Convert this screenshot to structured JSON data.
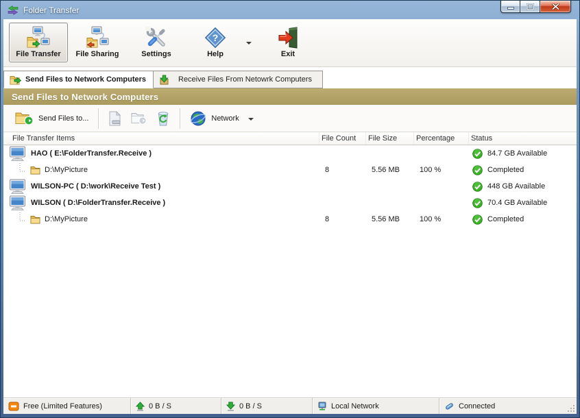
{
  "window": {
    "title": "Folder Transfer"
  },
  "toolbar": {
    "file_transfer": "File Transfer",
    "file_sharing": "File Sharing",
    "settings": "Settings",
    "help": "Help",
    "exit": "Exit"
  },
  "tabs": {
    "send": "Send Files to Network Computers",
    "receive": "Receive Files From Netowrk Computers"
  },
  "section_title": "Send Files to Network Computers",
  "actions": {
    "send_files": "Send Files to...",
    "network": "Network"
  },
  "table": {
    "columns": [
      "File Transfer Items",
      "File Count",
      "File Size",
      "Percentage",
      "Status"
    ],
    "rows": [
      {
        "type": "computer",
        "name": "HAO ( E:\\FolderTransfer.Receive )",
        "file_count": "",
        "file_size": "",
        "percentage": "",
        "status": "84.7 GB Available"
      },
      {
        "type": "folder",
        "name": "D:\\MyPicture",
        "file_count": "8",
        "file_size": "5.56 MB",
        "percentage": "100 %",
        "status": "Completed"
      },
      {
        "type": "computer",
        "name": "WILSON-PC ( D:\\work\\Receive Test )",
        "file_count": "",
        "file_size": "",
        "percentage": "",
        "status": "448 GB Available"
      },
      {
        "type": "computer",
        "name": "WILSON ( D:\\FolderTransfer.Receive )",
        "file_count": "",
        "file_size": "",
        "percentage": "",
        "status": "70.4 GB Available"
      },
      {
        "type": "folder",
        "name": "D:\\MyPicture",
        "file_count": "8",
        "file_size": "5.56 MB",
        "percentage": "100 %",
        "status": "Completed"
      }
    ]
  },
  "statusbar": {
    "license": "Free (Limited Features)",
    "upload": "0 B / S",
    "download": "0 B / S",
    "network": "Local Network",
    "connection": "Connected"
  },
  "colors": {
    "section_olive": "#b3a469",
    "status_green": "#2fae3c",
    "titlebar_blue": "#5480ae",
    "close_red": "#c03a17"
  }
}
